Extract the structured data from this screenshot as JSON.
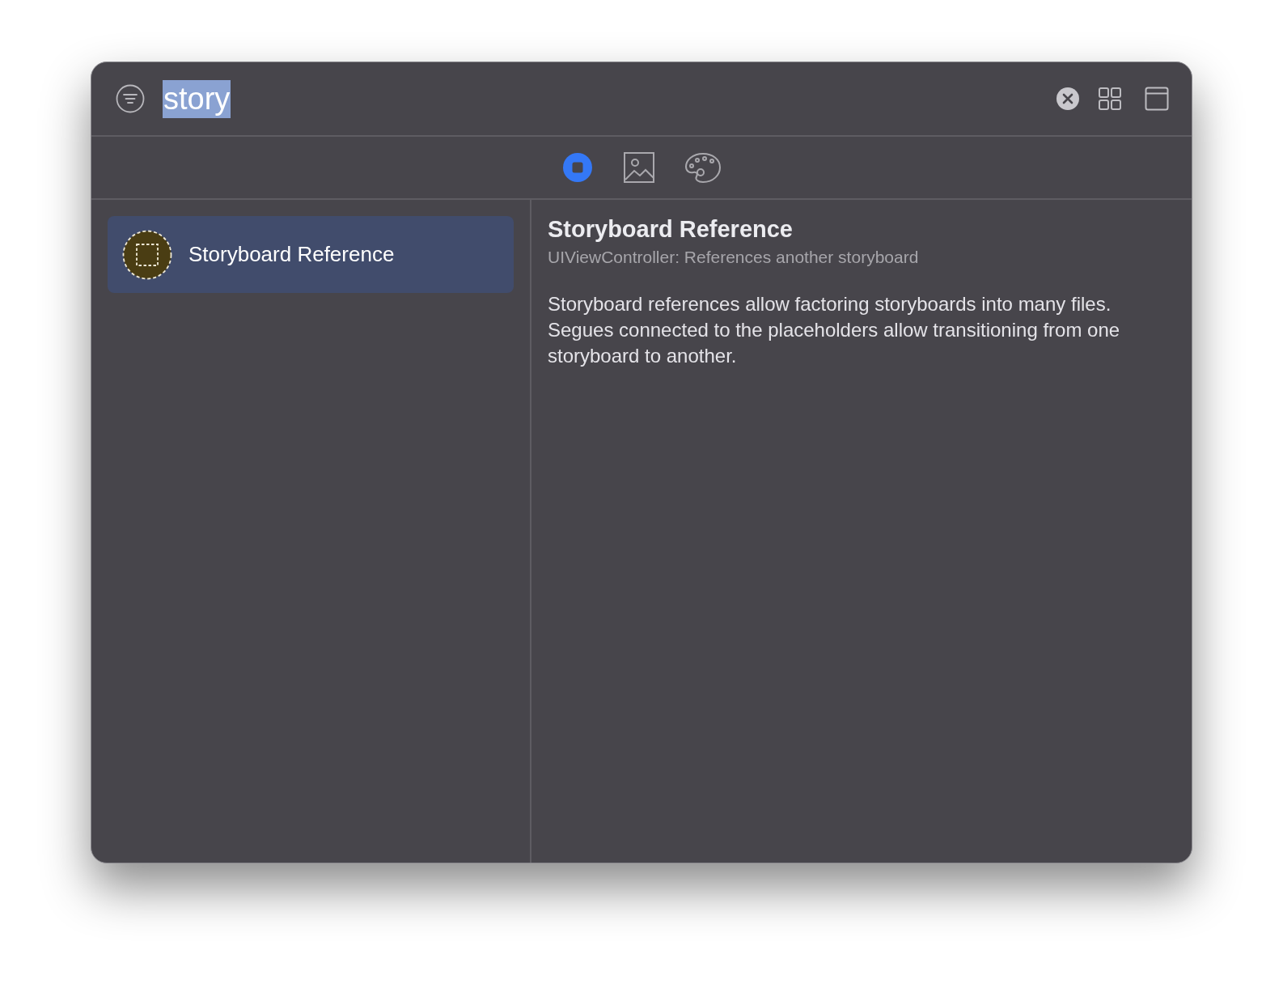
{
  "search": {
    "value": "story",
    "text_selected": true
  },
  "tabs": [
    {
      "kind": "objects",
      "selected": true
    },
    {
      "kind": "media",
      "selected": false
    },
    {
      "kind": "colors",
      "selected": false
    }
  ],
  "results": [
    {
      "title": "Storyboard Reference",
      "selected": true
    }
  ],
  "detail": {
    "title": "Storyboard Reference",
    "subtitle": "UIViewController: References another storyboard",
    "description": "Storyboard references allow factoring storyboards into many files. Segues connected to the placeholders allow transitioning from one storyboard to another."
  }
}
